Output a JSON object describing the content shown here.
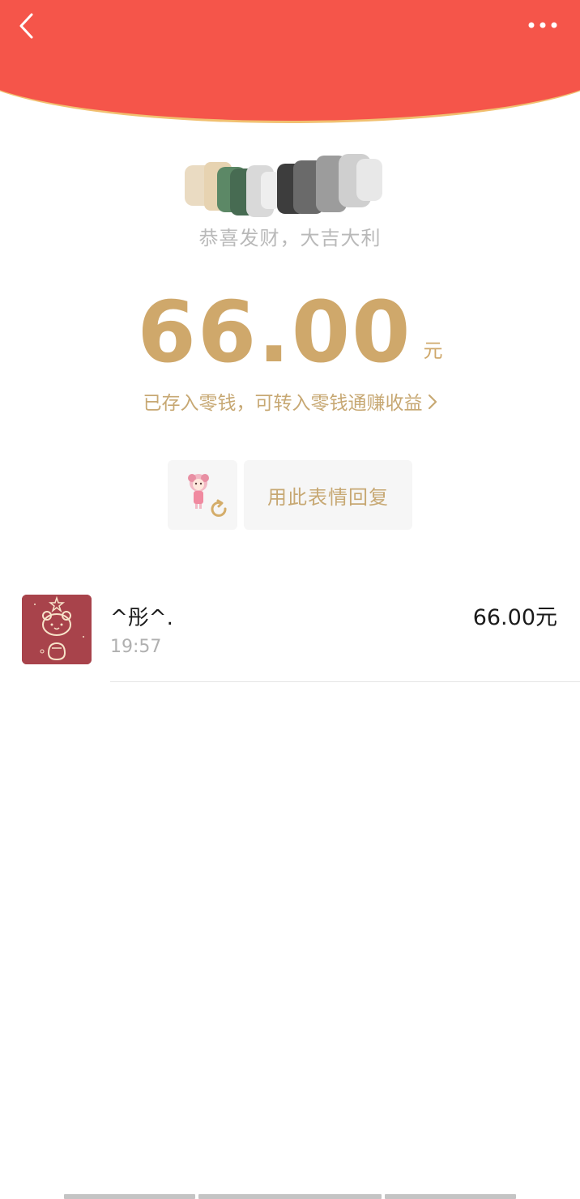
{
  "header": {
    "back_icon": "chevron-left-icon",
    "more_icon": "more-horizontal-icon",
    "accent_color": "#f5554a",
    "border_color": "#f1c070"
  },
  "red_packet": {
    "blessing": "恭喜发财，大吉大利",
    "amount": "66.00",
    "currency": "元",
    "saved_hint": "已存入零钱，可转入零钱通赚收益",
    "gold_color": "#cfa86b"
  },
  "reply": {
    "sticker_icon": "sticker-refresh-icon",
    "label": "用此表情回复"
  },
  "records": [
    {
      "name": "^彤^.",
      "time": "19:57",
      "amount": "66.00元",
      "avatar_icon": "bear-avatar-icon"
    }
  ]
}
